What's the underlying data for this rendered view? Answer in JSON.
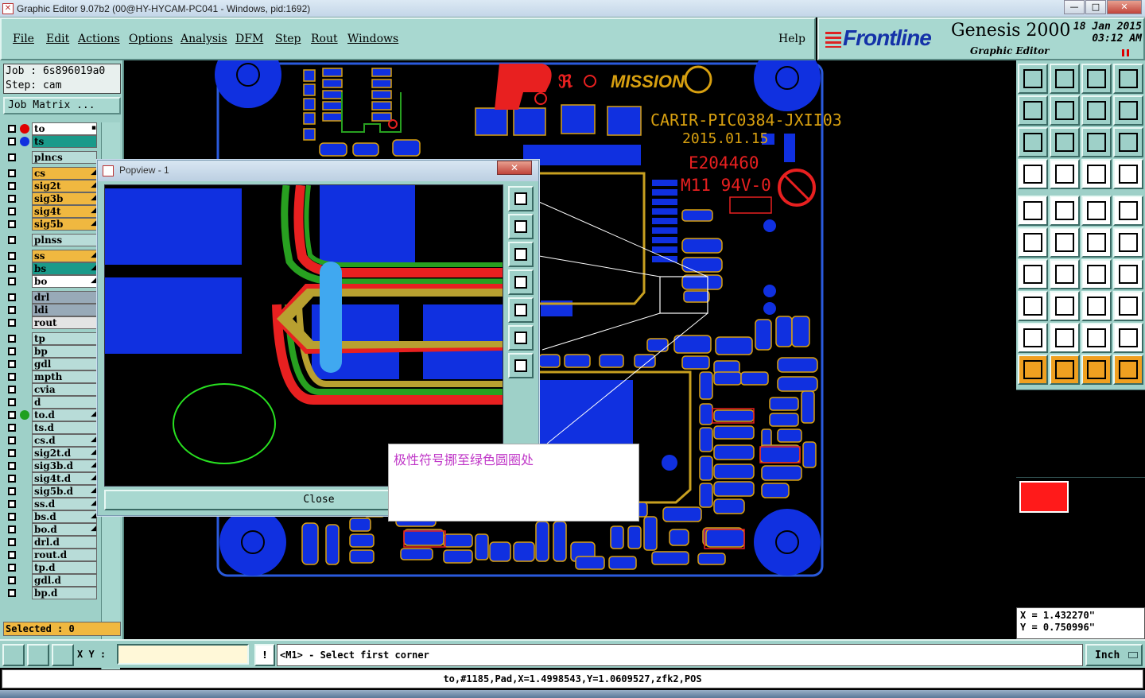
{
  "window": {
    "title": "Graphic Editor 9.07b2 (00@HY-HYCAM-PC041 - Windows, pid:1692)",
    "minimize": "—",
    "maximize": "□",
    "close": "✕"
  },
  "menu": {
    "items": [
      "File",
      "Edit",
      "Actions",
      "Options",
      "Analysis",
      "DFM",
      "Step",
      "Rout",
      "Windows"
    ],
    "help": "Help"
  },
  "brand": {
    "logo": "Frontline",
    "product": "Genesis 2000",
    "subtitle": "Graphic Editor",
    "date": "18 Jan 2015",
    "time": "03:12 AM"
  },
  "job": {
    "job_line": "Job : 6s896019a0",
    "step_line": "Step: cam",
    "matrix_button": "Job Matrix ..."
  },
  "layers": [
    {
      "name": "to",
      "color": "#ffffff",
      "dot": "#e00000",
      "mark": "▪",
      "checked": true
    },
    {
      "name": "ts",
      "color": "#1a9a8a",
      "dot": "#1030e0",
      "mark": "",
      "checked": false
    },
    {
      "name": "plncs",
      "color": "#b8dcd8",
      "dot": "",
      "mark": "",
      "gap": true
    },
    {
      "name": "cs",
      "color": "#f0b840",
      "dot": "",
      "mark": "◢",
      "gap": true
    },
    {
      "name": "sig2t",
      "color": "#f0b840",
      "dot": "",
      "mark": "◢"
    },
    {
      "name": "sig3b",
      "color": "#f0b840",
      "dot": "",
      "mark": "◢"
    },
    {
      "name": "sig4t",
      "color": "#f0b840",
      "dot": "",
      "mark": "◢"
    },
    {
      "name": "sig5b",
      "color": "#f0b840",
      "dot": "",
      "mark": "◢"
    },
    {
      "name": "plnss",
      "color": "#b8dcd8",
      "dot": "",
      "mark": "",
      "gap": true
    },
    {
      "name": "ss",
      "color": "#f0b840",
      "dot": "",
      "mark": "◢",
      "gap": true
    },
    {
      "name": "bs",
      "color": "#1a9a8a",
      "dot": "",
      "mark": "◢"
    },
    {
      "name": "bo",
      "color": "#ffffff",
      "dot": "",
      "mark": "◢"
    },
    {
      "name": "drl",
      "color": "#98aab8",
      "dot": "",
      "mark": "",
      "gap": true
    },
    {
      "name": "ldi",
      "color": "#98aab8",
      "dot": "",
      "mark": ""
    },
    {
      "name": "rout",
      "color": "#e4e4e4",
      "dot": "",
      "mark": ""
    },
    {
      "name": "tp",
      "color": "#b8dcd8",
      "dot": "",
      "mark": "",
      "gap": true
    },
    {
      "name": "bp",
      "color": "#b8dcd8",
      "dot": "",
      "mark": ""
    },
    {
      "name": "gdl",
      "color": "#b8dcd8",
      "dot": "",
      "mark": ""
    },
    {
      "name": "mpth",
      "color": "#b8dcd8",
      "dot": "",
      "mark": ""
    },
    {
      "name": "cvia",
      "color": "#b8dcd8",
      "dot": "",
      "mark": ""
    },
    {
      "name": "d",
      "color": "#b8dcd8",
      "dot": "",
      "mark": ""
    },
    {
      "name": "to.d",
      "color": "#b8dcd8",
      "dot": "#20a020",
      "mark": "◢"
    },
    {
      "name": "ts.d",
      "color": "#b8dcd8",
      "dot": "",
      "mark": ""
    },
    {
      "name": "cs.d",
      "color": "#b8dcd8",
      "dot": "",
      "mark": "◢"
    },
    {
      "name": "sig2t.d",
      "color": "#b8dcd8",
      "dot": "",
      "mark": "◢"
    },
    {
      "name": "sig3b.d",
      "color": "#b8dcd8",
      "dot": "",
      "mark": "◢"
    },
    {
      "name": "sig4t.d",
      "color": "#b8dcd8",
      "dot": "",
      "mark": "◢"
    },
    {
      "name": "sig5b.d",
      "color": "#b8dcd8",
      "dot": "",
      "mark": "◢"
    },
    {
      "name": "ss.d",
      "color": "#b8dcd8",
      "dot": "",
      "mark": "◢"
    },
    {
      "name": "bs.d",
      "color": "#b8dcd8",
      "dot": "",
      "mark": "◢"
    },
    {
      "name": "bo.d",
      "color": "#b8dcd8",
      "dot": "",
      "mark": "◢"
    },
    {
      "name": "drl.d",
      "color": "#b8dcd8",
      "dot": "",
      "mark": ""
    },
    {
      "name": "rout.d",
      "color": "#b8dcd8",
      "dot": "",
      "mark": ""
    },
    {
      "name": "tp.d",
      "color": "#b8dcd8",
      "dot": "",
      "mark": ""
    },
    {
      "name": "gdl.d",
      "color": "#b8dcd8",
      "dot": "",
      "mark": ""
    },
    {
      "name": "bp.d",
      "color": "#b8dcd8",
      "dot": "",
      "mark": ""
    }
  ],
  "selected": "Selected : 0",
  "board": {
    "marking_1": "CARIR-PIC0384-JXII03",
    "marking_2": "2015.01.15",
    "marking_3": "E204460",
    "marking_4": "M11 94V-0",
    "logo_text": "MISSION"
  },
  "popview": {
    "title": "Popview - 1",
    "close_x": "✕",
    "close_button": "Close"
  },
  "note": "极性符号挪至绿色圆圈处",
  "coords": {
    "x": "X  =  1.432270\"",
    "y": "Y  =  0.750996\""
  },
  "bottom": {
    "xy_label": "X Y :",
    "xy_value": "",
    "warn": "!",
    "prompt": "<M1> - Select first corner",
    "unit": "Inch"
  },
  "status": "to,#1185,Pad,X=1.4998543,Y=1.0609527,zfk2,POS",
  "icons": {
    "right_toolbar": [
      "zoom-in-icon",
      "zoom-out-icon",
      "home-icon",
      "window-icon",
      "pan-left-icon",
      "pan-right-icon",
      "fit-icon",
      "measure-icon",
      "fit-all-icon",
      "fit-selection-icon",
      "one-to-one-icon",
      "help-icon",
      "settings-icon",
      "grid-icon",
      "layers-icon",
      "layers-alt-icon",
      "snap-icon",
      "draw-icon",
      "ruler-icon",
      "point-icon",
      "connect-icon",
      "cross-icon",
      "line-icon",
      "line-alt-icon",
      "angle-icon",
      "slash-icon",
      "rotate-icon",
      "flip-icon",
      "move-icon",
      "minus-icon",
      "center-icon",
      "group-icon",
      "triangle-icon",
      "triangle-alt-icon",
      "arc-icon",
      "arc-alt-icon",
      "select-icon",
      "select-box-icon",
      "select-circle-icon",
      "select-multi-icon"
    ],
    "popview_tools": [
      "popview-fit-icon",
      "popview-up-icon",
      "popview-down-icon",
      "popview-left-icon",
      "popview-right-icon",
      "popview-zoom-icon",
      "popview-pan-icon"
    ]
  }
}
